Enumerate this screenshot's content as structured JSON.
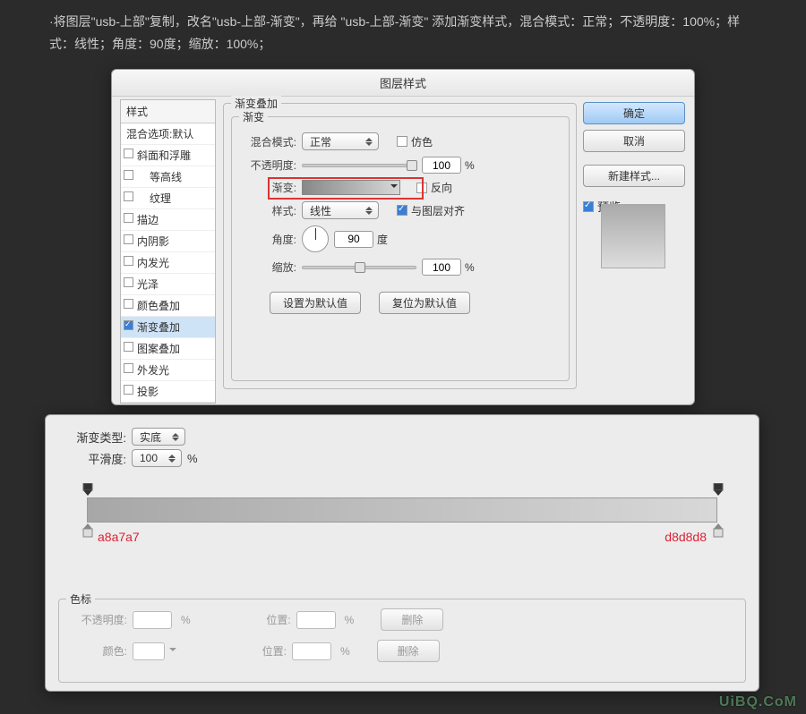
{
  "instructions": {
    "line": "·将图层\"usb-上部\"复制，改名\"usb-上部-渐变\"，再给 \"usb-上部-渐变\" 添加渐变样式，混合模式：正常；不透明度：100%；样式：线性；角度：90度；缩放：100%；"
  },
  "dialog1": {
    "title": "图层样式",
    "styles_header": "样式",
    "blend_options": "混合选项:默认",
    "items": [
      "斜面和浮雕",
      "等高线",
      "纹理",
      "描边",
      "内阴影",
      "内发光",
      "光泽",
      "颜色叠加",
      "渐变叠加",
      "图案叠加",
      "外发光",
      "投影"
    ],
    "group_outer": "渐变叠加",
    "group_inner": "渐变",
    "rows": {
      "blend_mode": {
        "lbl": "混合模式:",
        "value": "正常",
        "dither": "仿色"
      },
      "opacity": {
        "lbl": "不透明度:",
        "value": "100",
        "unit": "%"
      },
      "gradient": {
        "lbl": "渐变:",
        "reverse": "反向"
      },
      "style": {
        "lbl": "样式:",
        "value": "线性",
        "align": "与图层对齐"
      },
      "angle": {
        "lbl": "角度:",
        "value": "90",
        "unit": "度"
      },
      "scale": {
        "lbl": "缩放:",
        "value": "100",
        "unit": "%"
      }
    },
    "set_default": "设置为默认值",
    "reset_default": "复位为默认值",
    "ok": "确定",
    "cancel": "取消",
    "new_style": "新建样式...",
    "preview": "预览"
  },
  "dialog2": {
    "type_lbl": "渐变类型:",
    "type_val": "实底",
    "smooth_lbl": "平滑度:",
    "smooth_val": "100",
    "smooth_unit": "%",
    "left_color": "a8a7a7",
    "right_color": "d8d8d8",
    "colors_group": "色标",
    "opacity_lbl": "不透明度:",
    "position_lbl": "位置:",
    "color_lbl": "颜色:",
    "delete": "删除",
    "percent": "%"
  },
  "watermark": "UiBQ.CoM"
}
